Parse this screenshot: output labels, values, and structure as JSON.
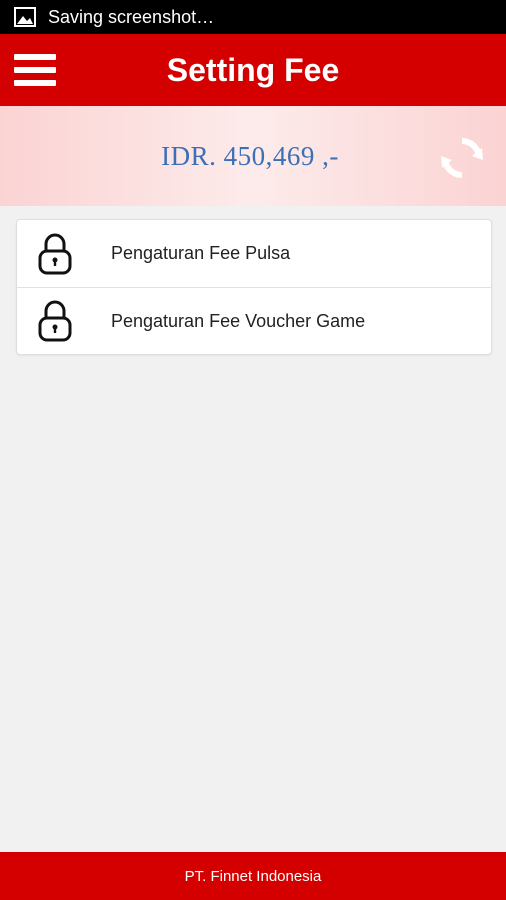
{
  "status_bar": {
    "notification": "Saving screenshot…",
    "icon": "image-icon"
  },
  "header": {
    "title": "Setting Fee",
    "menu_icon": "hamburger-menu-icon"
  },
  "balance": {
    "text": "IDR. 450,469 ,-",
    "refresh_icon": "refresh-icon"
  },
  "menu": {
    "items": [
      {
        "label": "Pengaturan Fee Pulsa",
        "icon": "lock-icon"
      },
      {
        "label": "Pengaturan Fee Voucher Game",
        "icon": "lock-icon"
      }
    ]
  },
  "footer": {
    "text": "PT. Finnet Indonesia"
  },
  "colors": {
    "primary": "#d40000",
    "balance_text": "#3b6fb6",
    "background": "#f1f1f1"
  }
}
